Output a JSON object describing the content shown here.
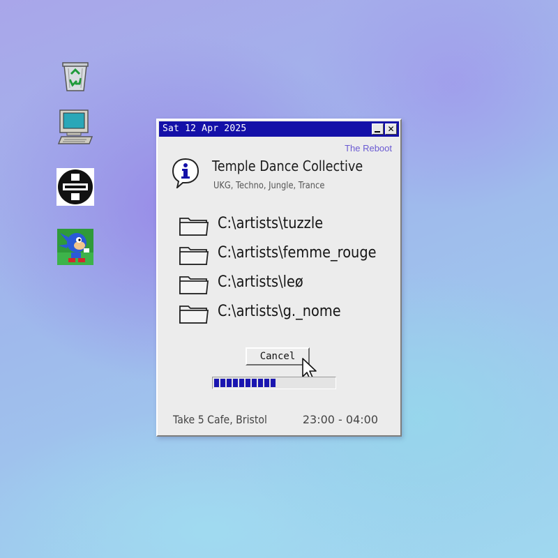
{
  "desktop": {
    "icons": [
      {
        "name": "recycle-bin-icon"
      },
      {
        "name": "my-computer-icon"
      },
      {
        "name": "temple-logo-icon"
      },
      {
        "name": "sonic-game-icon"
      }
    ]
  },
  "window": {
    "title": "Sat 12 Apr 2025",
    "brand": "The Reboot",
    "icon": "info-icon",
    "heading": "Temple Dance Collective",
    "subheading": "UKG, Techno, Jungle, Trance",
    "folders": [
      {
        "label": "C:\\artists\\tuzzle",
        "icon": "folder-icon"
      },
      {
        "label": "C:\\artists\\femme_rouge",
        "icon": "folder-icon"
      },
      {
        "label": "C:\\artists\\leø",
        "icon": "folder-icon"
      },
      {
        "label": "C:\\artists\\g._nome",
        "icon": "folder-icon"
      }
    ],
    "cancel_label": "Cancel",
    "progress": 0.52,
    "venue": "Take 5 Cafe, Bristol",
    "time": "23:00 - 04:00"
  },
  "colors": {
    "titlebar": "#1410a8",
    "progress": "#1a16b0",
    "brand": "#6a5ad2",
    "window_bg": "#ececec"
  }
}
